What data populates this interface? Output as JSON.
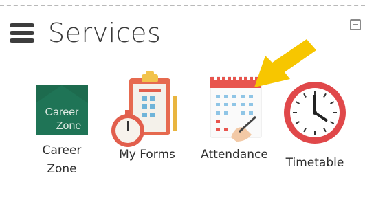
{
  "panel": {
    "title": "Services",
    "icons": {
      "menu": "hamburger-menu-icon",
      "collapse": "collapse-icon"
    }
  },
  "services": [
    {
      "label_line1": "Career",
      "label_line2": "Zone",
      "icon": "career-zone-logo",
      "logo_text_line1": "Career",
      "logo_text_line2": "Zone"
    },
    {
      "label": "My Forms",
      "icon": "clipboard-stopwatch-icon"
    },
    {
      "label": "Attendance",
      "icon": "calendar-pen-icon"
    },
    {
      "label": "Timetable",
      "icon": "clock-icon"
    }
  ],
  "annotation": {
    "icon": "yellow-arrow-icon",
    "color": "#f7c600"
  },
  "colors": {
    "career_zone_bg": "#1d6b4e",
    "clock_ring": "#e0484a",
    "calendar_red": "#e8554e"
  }
}
